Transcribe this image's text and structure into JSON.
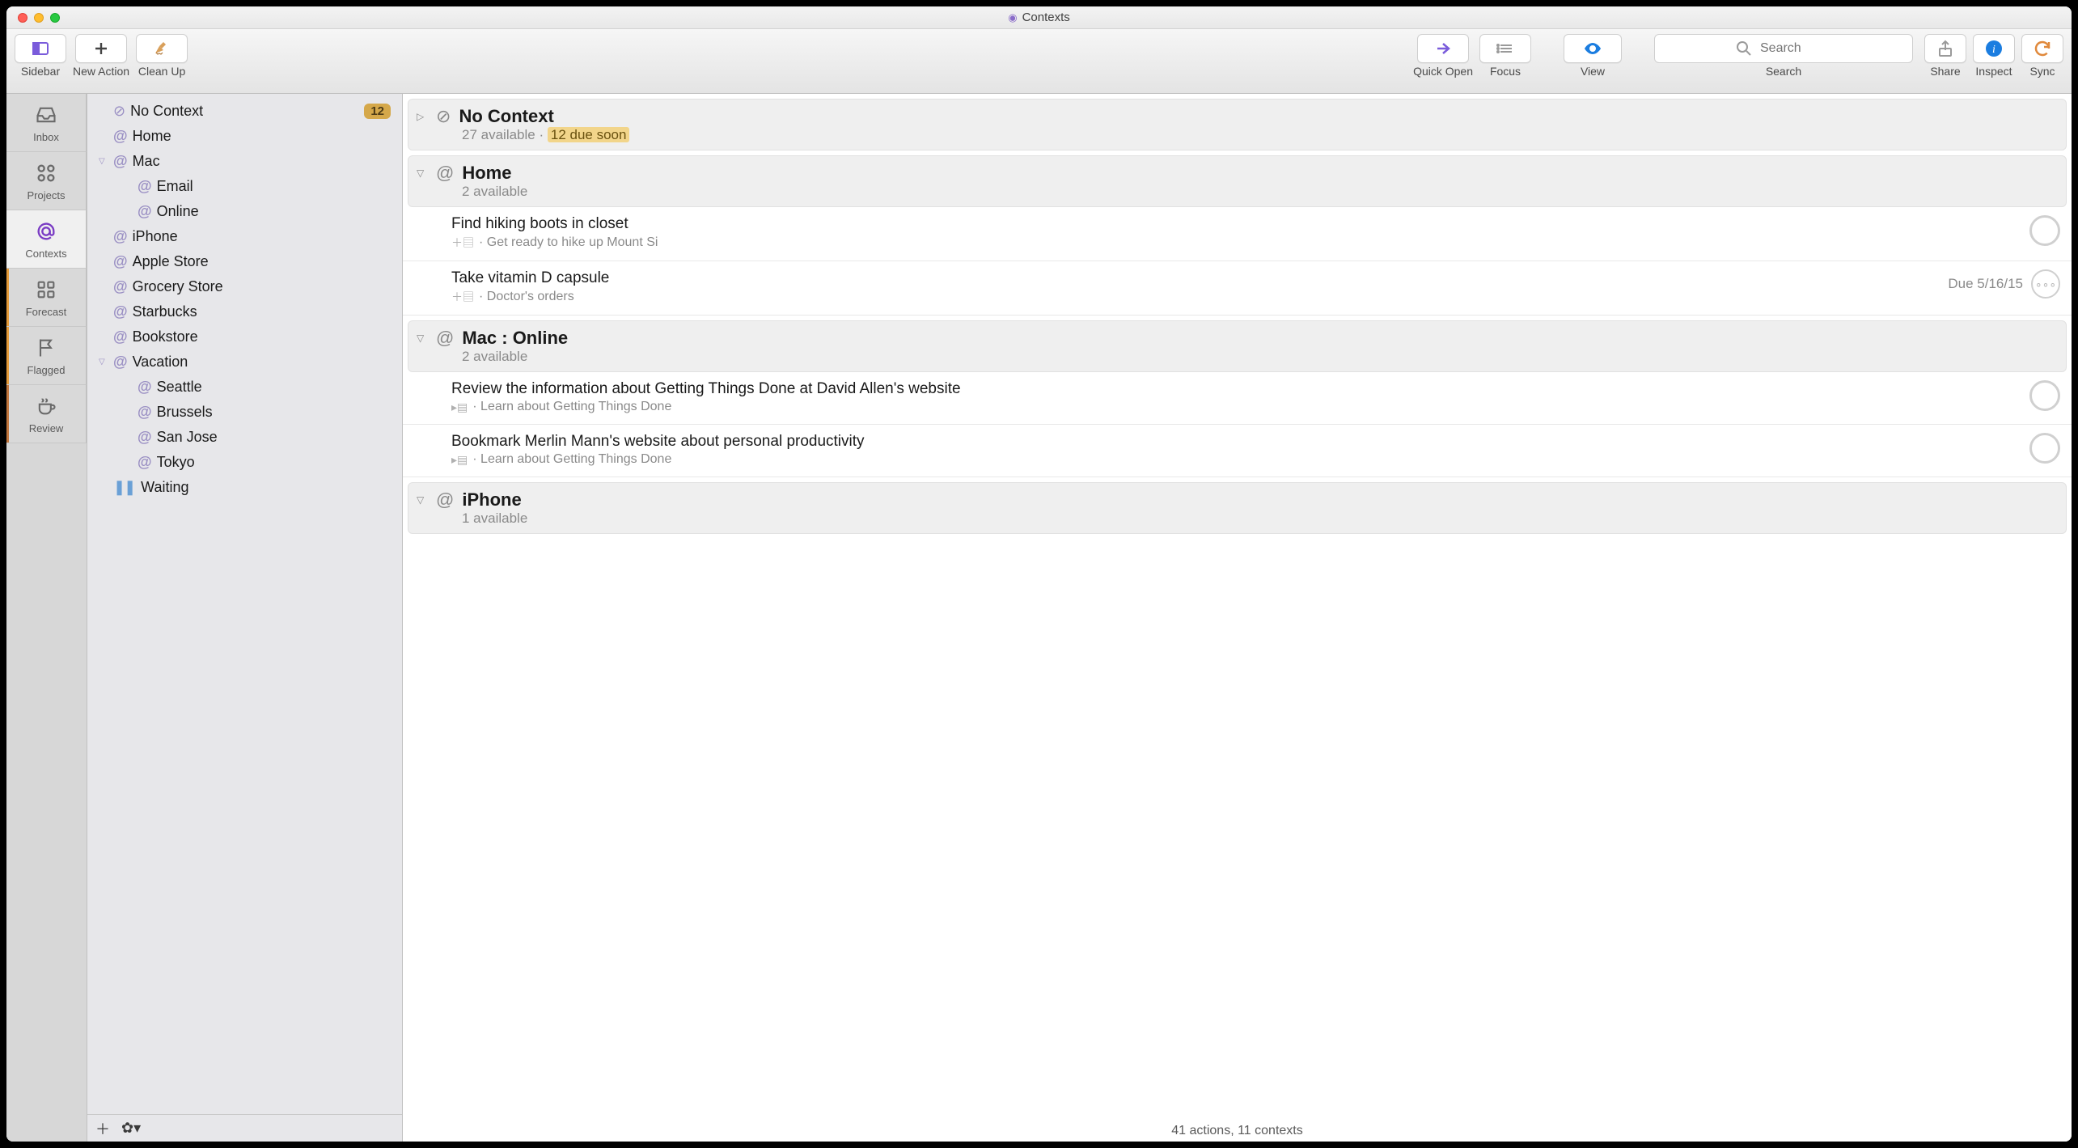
{
  "window": {
    "title": "Contexts"
  },
  "toolbar": {
    "sidebar": "Sidebar",
    "new_action": "New Action",
    "clean_up": "Clean Up",
    "quick_open": "Quick Open",
    "focus": "Focus",
    "view": "View",
    "search_label": "Search",
    "search_placeholder": "Search",
    "share": "Share",
    "inspect": "Inspect",
    "sync": "Sync"
  },
  "perspectives": {
    "inbox": "Inbox",
    "projects": "Projects",
    "contexts": "Contexts",
    "forecast": "Forecast",
    "flagged": "Flagged",
    "review": "Review"
  },
  "tree": {
    "items": [
      {
        "label": "No Context",
        "badge": "12",
        "type": "nocontext",
        "indent": 0
      },
      {
        "label": "Home",
        "indent": 0
      },
      {
        "label": "Mac",
        "indent": 0,
        "expanded": true
      },
      {
        "label": "Email",
        "indent": 1
      },
      {
        "label": "Online",
        "indent": 1
      },
      {
        "label": "iPhone",
        "indent": 0
      },
      {
        "label": "Apple Store",
        "indent": 0
      },
      {
        "label": "Grocery Store",
        "indent": 0
      },
      {
        "label": "Starbucks",
        "indent": 0
      },
      {
        "label": "Bookstore",
        "indent": 0
      },
      {
        "label": "Vacation",
        "indent": 0,
        "expanded": true
      },
      {
        "label": "Seattle",
        "indent": 1
      },
      {
        "label": "Brussels",
        "indent": 1
      },
      {
        "label": "San Jose",
        "indent": 1
      },
      {
        "label": "Tokyo",
        "indent": 1
      },
      {
        "label": "Waiting",
        "indent": 0,
        "type": "waiting"
      }
    ]
  },
  "groups": [
    {
      "title": "No Context",
      "subtitle_available": "27 available",
      "due_text": "12 due soon",
      "collapsed": true,
      "nocontext": true,
      "tasks": []
    },
    {
      "title": "Home",
      "subtitle_available": "2 available",
      "tasks": [
        {
          "title": "Find hiking boots in closet",
          "project": "Get ready to hike up Mount Si",
          "ptype": "plus"
        },
        {
          "title": "Take vitamin D capsule",
          "project": "Doctor's orders",
          "ptype": "plus",
          "due": "Due 5/16/15",
          "repeat": true
        }
      ]
    },
    {
      "title": "Mac : Online",
      "subtitle_available": "2 available",
      "tasks": [
        {
          "title": "Review the information about Getting Things Done at David Allen's website",
          "project": "Learn about Getting Things Done",
          "ptype": "seq"
        },
        {
          "title": "Bookmark Merlin Mann's website about personal productivity",
          "project": "Learn about Getting Things Done",
          "ptype": "seq"
        }
      ]
    },
    {
      "title": "iPhone",
      "subtitle_available": "1 available",
      "tasks": []
    }
  ],
  "status": "41 actions, 11 contexts"
}
